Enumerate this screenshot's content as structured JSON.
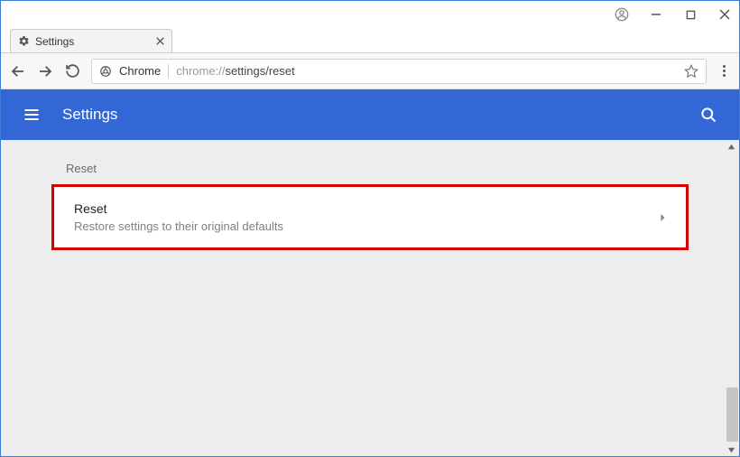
{
  "window": {
    "tab_title": "Settings"
  },
  "toolbar": {
    "prefix_label": "Chrome",
    "url_protocol": "chrome://",
    "url_path": "settings/reset"
  },
  "appbar": {
    "title": "Settings"
  },
  "content": {
    "section_label": "Reset",
    "reset_card": {
      "title": "Reset",
      "description": "Restore settings to their original defaults"
    }
  }
}
